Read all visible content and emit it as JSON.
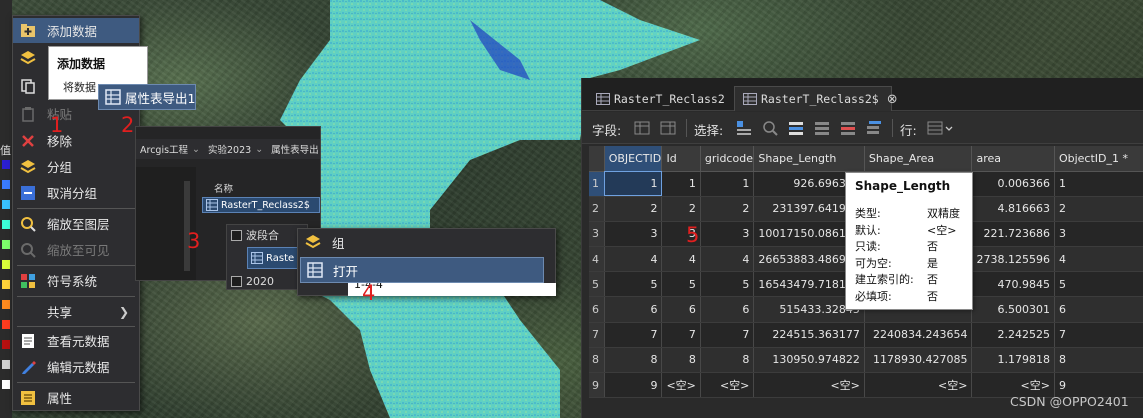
{
  "context_menu": {
    "items": [
      {
        "label": "添加数据",
        "icon": "add-data-icon",
        "highlighted": true
      },
      {
        "label": "",
        "icon": "layers-icon"
      },
      {
        "label": "",
        "icon": "copy-icon"
      },
      {
        "label": "粘贴",
        "icon": "paste-icon",
        "disabled": true
      },
      {
        "label": "移除",
        "icon": "remove-icon"
      },
      {
        "label": "分组",
        "icon": "group-icon"
      },
      {
        "label": "取消分组",
        "icon": "ungroup-icon"
      },
      {
        "label": "缩放至图层",
        "icon": "zoom-layer-icon"
      },
      {
        "label": "缩放至可见",
        "icon": "zoom-visible-icon",
        "disabled": true
      },
      {
        "label": "符号系统",
        "icon": "symbology-icon"
      },
      {
        "label": "共享",
        "icon": ""
      },
      {
        "label": "查看元数据",
        "icon": "view-metadata-icon"
      },
      {
        "label": "编辑元数据",
        "icon": "edit-metadata-icon"
      },
      {
        "label": "属性",
        "icon": "properties-icon"
      }
    ],
    "tooltip_title": "添加数据",
    "tooltip_desc": "将数据"
  },
  "export_popup": {
    "label": "属性表导出1",
    "icon": "table-icon"
  },
  "catalog": {
    "path": [
      "Arcgis工程",
      "实验2023",
      "属性表导出"
    ],
    "column_header": "名称",
    "selected_item": "RasterT_Reclass2$"
  },
  "layer_tree": {
    "rows": [
      "波段合",
      "2020"
    ],
    "selected": "Raste"
  },
  "menu2": {
    "group_label": "组",
    "open_label": "打开",
    "bottom_text": "1-4-4"
  },
  "steps": [
    "1",
    "2",
    "3",
    "4",
    "5"
  ],
  "legend_label": "值",
  "legend_colors": [
    "#2b1fd0",
    "#3a7bff",
    "#39c2ff",
    "#3cffd8",
    "#7dff6b",
    "#d9ff3a",
    "#ffd23a",
    "#ff8a1f",
    "#ff3c1f",
    "#b51010",
    "#d0d0d0",
    "#ffffff"
  ],
  "attribute_table": {
    "tabs": [
      {
        "label": "RasterT_Reclass2",
        "active": false
      },
      {
        "label": "RasterT_Reclass2$",
        "active": true
      }
    ],
    "toolbar": {
      "field_label": "字段:",
      "select_label": "选择:",
      "row_label": "行:"
    },
    "columns": [
      "OBJECTID",
      "Id",
      "gridcode",
      "Shape_Length",
      "Shape_Area",
      "area",
      "ObjectID_1 *"
    ],
    "rows": [
      [
        "1",
        "1",
        "1",
        "1",
        "926.696341",
        "",
        "0.006366",
        "1"
      ],
      [
        "2",
        "2",
        "2",
        "2",
        "231397.641926",
        "",
        "4.816663",
        "2"
      ],
      [
        "3",
        "3",
        "3",
        "3",
        "10017150.086147",
        "",
        "221.723686",
        "3"
      ],
      [
        "4",
        "4",
        "4",
        "4",
        "26653883.486967",
        "",
        "2738.125596",
        "4"
      ],
      [
        "5",
        "5",
        "5",
        "5",
        "16543479.718177",
        "",
        "470.9845",
        "5"
      ],
      [
        "6",
        "6",
        "6",
        "6",
        "515433.32845",
        "",
        "6.500301",
        "6"
      ],
      [
        "7",
        "7",
        "7",
        "7",
        "224515.363177",
        "2240834.243654",
        "2.242525",
        "7"
      ],
      [
        "8",
        "8",
        "8",
        "8",
        "130950.974822",
        "1178930.427085",
        "1.179818",
        "8"
      ],
      [
        "9",
        "9",
        "<空>",
        "<空>",
        "<空>",
        "<空>",
        "<空>",
        "9"
      ]
    ]
  },
  "field_tooltip": {
    "title": "Shape_Length",
    "rows": [
      {
        "k": "类型:",
        "v": "双精度"
      },
      {
        "k": "默认:",
        "v": "<空>"
      },
      {
        "k": "只读:",
        "v": "否"
      },
      {
        "k": "可为空:",
        "v": "是"
      },
      {
        "k": "建立索引的:",
        "v": "否"
      },
      {
        "k": "必填项:",
        "v": "否"
      }
    ]
  },
  "watermark": "CSDN @OPPO2401",
  "colors": {
    "accent": "#3e5a80",
    "step_red": "#e01f1f",
    "raster_cyan": "#5fe0e0"
  }
}
